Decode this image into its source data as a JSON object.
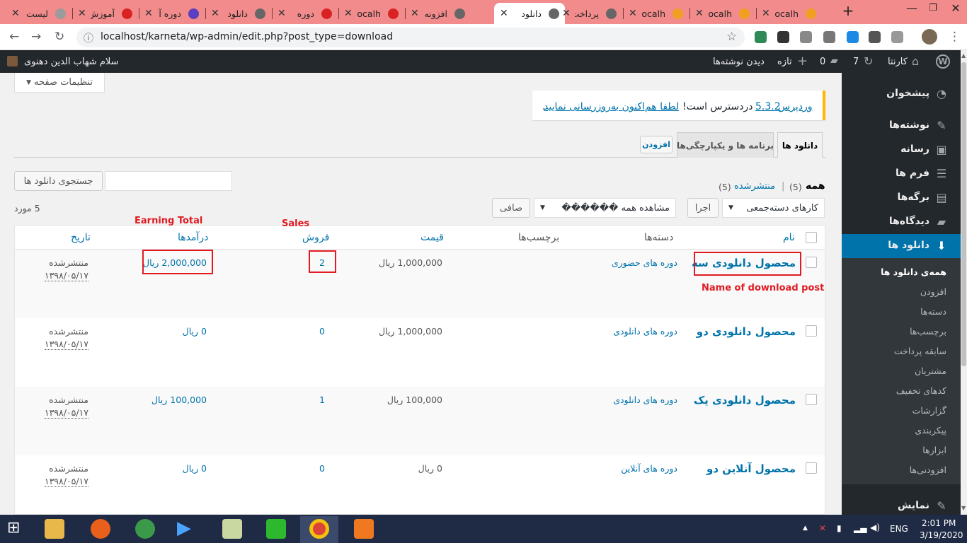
{
  "browser": {
    "tabs": [
      {
        "label": "لیست",
        "fav": "#9b9b9b"
      },
      {
        "label": "آموزش",
        "fav": "#d92323"
      },
      {
        "label": "دوره آ",
        "fav": "#5a3fc0"
      },
      {
        "label": "دانلود",
        "fav": "#666"
      },
      {
        "label": "دوره",
        "fav": "#d92323"
      },
      {
        "label": "localh",
        "fav": "#d92323"
      },
      {
        "label": "افزونه",
        "fav": "#666"
      },
      {
        "label": "دانلود",
        "fav": "#666"
      },
      {
        "label": "پرداخت",
        "fav": "#666"
      },
      {
        "label": "localh",
        "fav": "#f0a020"
      },
      {
        "label": "localh",
        "fav": "#f0a020"
      },
      {
        "label": "localh",
        "fav": "#f0a020"
      }
    ],
    "close_glyph": "✕",
    "new_tab": "+",
    "url": "localhost/karneta/wp-admin/edit.php?post_type=download"
  },
  "adminbar": {
    "site": "کارنتا",
    "updates": "7",
    "comments": "0",
    "new": "تازه",
    "view_posts": "دیدن نوشته‌ها",
    "greeting": "سلام شهاب الدین دهنوی"
  },
  "sidebar": {
    "items": [
      {
        "label": "پیشخوان",
        "icon": "dashboard-icon"
      },
      {
        "label": "نوشته‌ها",
        "icon": "pin-icon"
      },
      {
        "label": "رسانه",
        "icon": "media-icon"
      },
      {
        "label": "فرم ها",
        "icon": "forms-icon"
      },
      {
        "label": "برگه‌ها",
        "icon": "pages-icon"
      },
      {
        "label": "دیدگاه‌ها",
        "icon": "comments-icon"
      },
      {
        "label": "دانلود ها",
        "icon": "download-icon"
      },
      {
        "label": "نمایش",
        "icon": "appearance-icon"
      }
    ],
    "subitems": [
      "همه‌ی دانلود ها",
      "افزودن",
      "دسته‌ها",
      "برچسب‌ها",
      "سابقه پرداخت",
      "مشتریان",
      "کدهای تخفیف",
      "گزارشات",
      "پیکربندی",
      "ابزارها",
      "افزودنی‌ها"
    ]
  },
  "screen_options": "تنظیمات صفحه",
  "notice": {
    "pre": "وردپرس",
    "version": "5.3.2",
    "mid": "دردسترس است!",
    "link": "لطفا هم‌اکنون به‌روزرسانی نمایید",
    "post": "."
  },
  "nav_tabs": {
    "downloads": "دانلود ها",
    "apps": "برنامه ها و یکپارچگی‌ها",
    "add": "افزودن"
  },
  "filters": {
    "all": "همه",
    "all_count": "(5)",
    "sep": "|",
    "published": "منتشرشده",
    "published_count": "(5)",
    "search_button": "جستجوی دانلود ها",
    "bulk_select": "کارهای دسته‌جمعی",
    "apply": "اجرا",
    "view_select": "مشاهده همه ������",
    "filter_button": "صافی",
    "items_count": "5 مورد"
  },
  "table": {
    "headers": {
      "name": "نام",
      "categories": "دسته‌ها",
      "tags": "برچسب‌ها",
      "price": "قیمت",
      "sales": "فروش",
      "earnings": "درآمدها",
      "date": "تاریخ"
    },
    "rows": [
      {
        "name": "محصول دانلودی سه",
        "category": "دوره های حضوری",
        "price": "1,000,000 ریال",
        "sales": "2",
        "earnings": "2,000,000 ریال",
        "status": "منتشرشده",
        "date": "۱۳۹۸/۰۵/۱۷"
      },
      {
        "name": "محصول دانلودی دو",
        "category": "دوره های دانلودی",
        "price": "1,000,000 ریال",
        "sales": "0",
        "earnings": "0 ریال",
        "status": "منتشرشده",
        "date": "۱۳۹۸/۰۵/۱۷"
      },
      {
        "name": "محصول دانلودی یک",
        "category": "دوره های دانلودی",
        "price": "100,000 ریال",
        "sales": "1",
        "earnings": "100,000 ریال",
        "status": "منتشرشده",
        "date": "۱۳۹۸/۰۵/۱۷"
      },
      {
        "name": "محصول آنلاین دو",
        "category": "دوره های آنلاین",
        "price": "0 ریال",
        "sales": "0",
        "earnings": "0 ریال",
        "status": "منتشرشده",
        "date": "۱۳۹۸/۰۵/۱۷"
      }
    ]
  },
  "annotations": {
    "earning": "Earning Total",
    "sales": "Sales",
    "name": "Name of download post"
  },
  "taskbar": {
    "lang": "ENG",
    "time": "2:01 PM",
    "date": "3/19/2020"
  },
  "colors": {
    "wp_blue": "#0073aa",
    "admin_dark": "#23282d",
    "annotation_red": "#e01b22",
    "tabbar": "#f28b8b"
  }
}
